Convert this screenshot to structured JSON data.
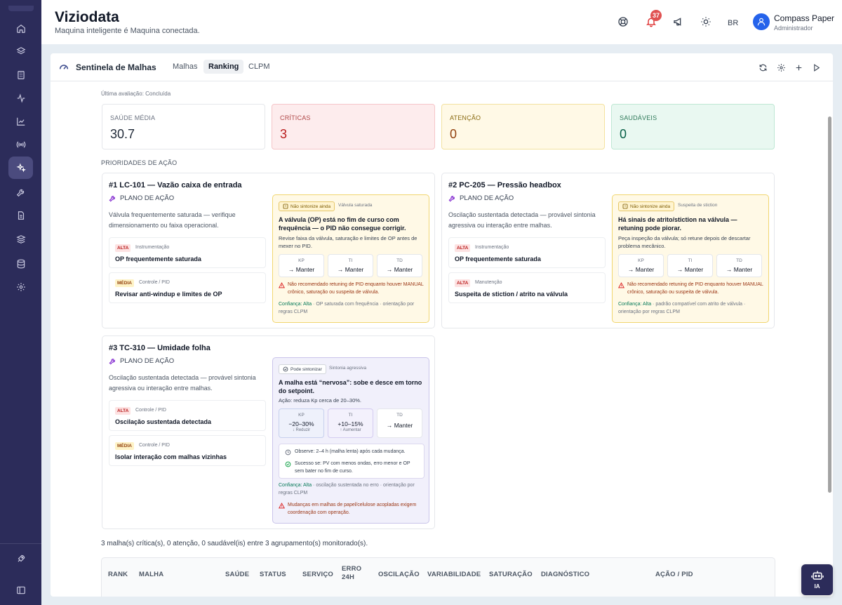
{
  "app": {
    "title": "Viziodata",
    "subtitle": "Maquina inteligente é Maquina conectada."
  },
  "header": {
    "notification_count": "37",
    "language": "BR",
    "user_name": "Compass Paper",
    "user_role": "Administrador"
  },
  "panel": {
    "title": "Sentinela de Malhas",
    "tabs": [
      "Malhas",
      "Ranking",
      "CLPM"
    ],
    "active_tab": "Ranking",
    "last_eval": "Última avaliação: Concluída"
  },
  "stats": [
    {
      "label": "SAÚDE MÉDIA",
      "value": "30.7"
    },
    {
      "label": "CRÍTICAS",
      "value": "3"
    },
    {
      "label": "ATENÇÃO",
      "value": "0"
    },
    {
      "label": "SAUDÁVEIS",
      "value": "0"
    }
  ],
  "section_title": "PRIORIDADES DE AÇÃO",
  "plan_label": "PLANO DE AÇÃO",
  "cards": [
    {
      "title": "#1 LC-101 — Vazão caixa de entrada",
      "desc": "Válvula frequentemente saturada — verifique dimensionamento ou faixa operacional.",
      "issues": [
        {
          "badge": "ALTA",
          "cat": "Instrumentação",
          "title": "OP frequentemente saturada"
        },
        {
          "badge": "MÉDIA",
          "cat": "Controle / PID",
          "title": "Revisar anti-windup e limites de OP"
        }
      ],
      "advice": {
        "pill": "Não sintonize ainda",
        "pill_sub": "Válvula saturada",
        "headline": "A válvula (OP) está no fim de curso com frequência — o PID não consegue corrigir.",
        "text": "Revise faixa da válvula, saturação e limites de OP antes de mexer no PID.",
        "kp": [
          {
            "label": "KP",
            "value": "→ Manter"
          },
          {
            "label": "TI",
            "value": "→ Manter"
          },
          {
            "label": "TD",
            "value": "→ Manter"
          }
        ],
        "warning": "Não recomendado retuning de PID enquanto houver MANUAL crônico, saturação ou suspeita de válvula.",
        "conf_label": "Confiança: Alta",
        "conf_text": " · OP saturada com frequência · orientação por regras CLPM"
      }
    },
    {
      "title": "#2 PC-205 — Pressão headbox",
      "desc": "Oscilação sustentada detectada — provável sintonia agressiva ou interação entre malhas.",
      "issues": [
        {
          "badge": "ALTA",
          "cat": "Instrumentação",
          "title": "OP frequentemente saturada"
        },
        {
          "badge": "ALTA",
          "cat": "Manutenção",
          "title": "Suspeita de stiction / atrito na válvula"
        }
      ],
      "advice": {
        "pill": "Não sintonize ainda",
        "pill_sub": "Suspeita de stiction",
        "headline": "Há sinais de atrito/stiction na válvula — retuning pode piorar.",
        "text": "Peça inspeção da válvula; só retune depois de descartar problema mecânico.",
        "kp": [
          {
            "label": "KP",
            "value": "→ Manter"
          },
          {
            "label": "TI",
            "value": "→ Manter"
          },
          {
            "label": "TD",
            "value": "→ Manter"
          }
        ],
        "warning": "Não recomendado retuning de PID enquanto houver MANUAL crônico, saturação ou suspeita de válvula.",
        "conf_label": "Confiança: Alta",
        "conf_text": " · padrão compatível com atrito de válvula · orientação por regras CLPM"
      }
    },
    {
      "title": "#3 TC-310 — Umidade folha",
      "desc": "Oscilação sustentada detectada — provável sintonia agressiva ou interação entre malhas.",
      "issues": [
        {
          "badge": "ALTA",
          "cat": "Controle / PID",
          "title": "Oscilação sustentada detectada"
        },
        {
          "badge": "MÉDIA",
          "cat": "Controle / PID",
          "title": "Isolar interação com malhas vizinhas"
        }
      ],
      "advice": {
        "pill": "Pode sintonizar",
        "pill_sub": "Sintonia agressiva",
        "headline": "A malha está “nervosa”: sobe e desce em torno do setpoint.",
        "text": "Ação: reduza Kp cerca de 20–30%.",
        "kp": [
          {
            "label": "KP",
            "value": "−20–30%",
            "sub": "↓ Reduzir"
          },
          {
            "label": "TI",
            "value": "+10–15%",
            "sub": "↑ Aumentar"
          },
          {
            "label": "TD",
            "value": "→ Manter"
          }
        ],
        "observe": "Observe: 2–4 h (malha lenta) após cada mudança.",
        "success": "Sucesso se: PV com menos ondas, erro menor e OP sem bater no fim de curso.",
        "conf_label": "Confiança: Alta",
        "conf_text": " · oscilação sustentada no erro · orientação por regras CLPM",
        "warning": "Mudanças em malhas de papel/celulose acopladas exigem coordenação com operação."
      }
    }
  ],
  "summary": "3 malha(s) crítica(s), 0 atenção, 0 saudável(is) entre 3 agrupamento(s) monitorado(s).",
  "table": {
    "headers": [
      "RANK",
      "MALHA",
      "SAÚDE",
      "STATUS",
      "SERVIÇO",
      "ERRO 24H",
      "OSCILAÇÃO",
      "VARIABILIDADE",
      "SATURAÇÃO",
      "DIAGNÓSTICO",
      "AÇÃO / PID"
    ]
  },
  "ia_label": "IA",
  "colors": {
    "sidebar": "#2c2c5a",
    "critical": "#b91c1c",
    "attention": "#92400e",
    "healthy": "#065f46",
    "accent": "#2563eb"
  }
}
